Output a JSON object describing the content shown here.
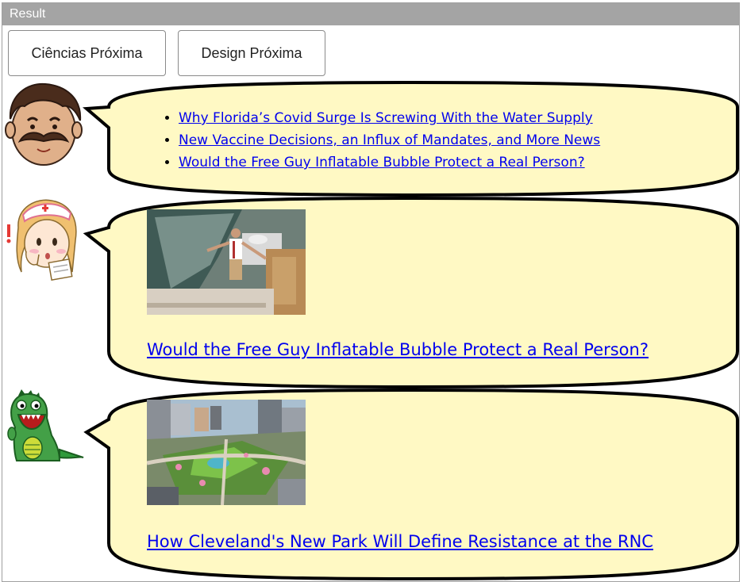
{
  "window": {
    "title": "Result"
  },
  "buttons": [
    {
      "label": "Ciências Próxima"
    },
    {
      "label": "Design Próxima"
    }
  ],
  "messages": [
    {
      "avatar": "mustache-man-icon",
      "links": [
        "Why Florida’s Covid Surge Is Screwing With the Water Supply",
        "New Vaccine Decisions, an Influx of Mandates, and More News",
        "Would the Free Guy Inflatable Bubble Protect a Real Person?"
      ]
    },
    {
      "avatar": "nurse-girl-icon",
      "image": "free-guy-bubble-photo",
      "link": "Would the Free Guy Inflatable Bubble Protect a Real Person?"
    },
    {
      "avatar": "green-dinosaur-icon",
      "image": "cleveland-park-photo",
      "link": "How Cleveland's New Park Will Define Resistance at the RNC"
    }
  ],
  "colors": {
    "bubble_fill": "#fff9c4",
    "bubble_stroke": "#000000",
    "titlebar": "#a4a4a4",
    "link": "#0000ee"
  }
}
